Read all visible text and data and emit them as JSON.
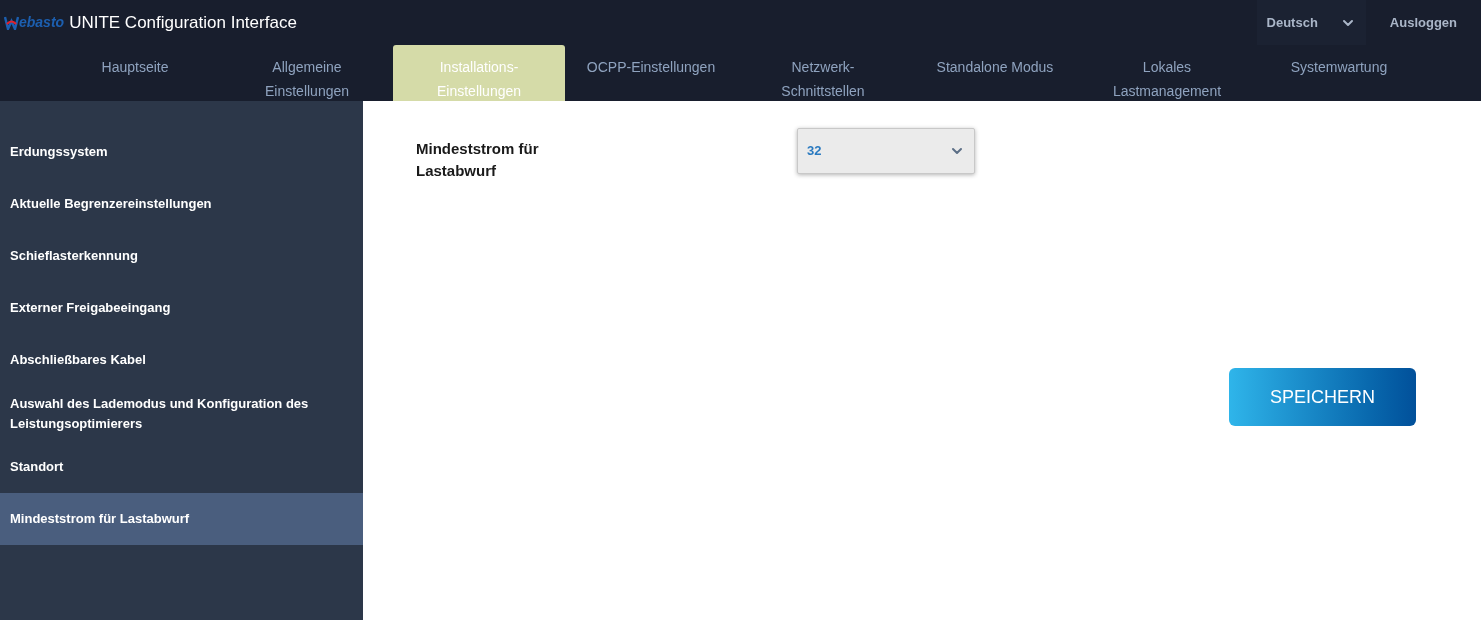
{
  "header": {
    "logo_text": "ebasto",
    "title": "UNITE Configuration Interface",
    "language": "Deutsch",
    "logout": "Ausloggen"
  },
  "tabs": [
    {
      "label": "Hauptseite",
      "selected": false
    },
    {
      "label": "Allgemeine Einstellungen",
      "selected": false
    },
    {
      "label": "Installations-Einstellungen",
      "selected": true
    },
    {
      "label": "OCPP-Einstellungen",
      "selected": false
    },
    {
      "label": "Netzwerk-Schnittstellen",
      "selected": false
    },
    {
      "label": "Standalone Modus",
      "selected": false
    },
    {
      "label": "Lokales Lastmanagement",
      "selected": false
    },
    {
      "label": "Systemwartung",
      "selected": false
    }
  ],
  "sidebar": {
    "items": [
      {
        "label": "Erdungssystem",
        "selected": false
      },
      {
        "label": "Aktuelle Begrenzereinstellungen",
        "selected": false
      },
      {
        "label": "Schieflasterkennung",
        "selected": false
      },
      {
        "label": "Externer Freigabeeingang",
        "selected": false
      },
      {
        "label": "Abschließbares Kabel",
        "selected": false
      },
      {
        "label": "Auswahl des Lademodus und Konfiguration des Leistungsoptimierers",
        "selected": false
      },
      {
        "label": "Standort",
        "selected": false
      },
      {
        "label": "Mindeststrom für Lastabwurf",
        "selected": true
      }
    ]
  },
  "form": {
    "label": "Mindeststrom für Lastabwurf",
    "value": "32",
    "save": "SPEICHERN"
  }
}
